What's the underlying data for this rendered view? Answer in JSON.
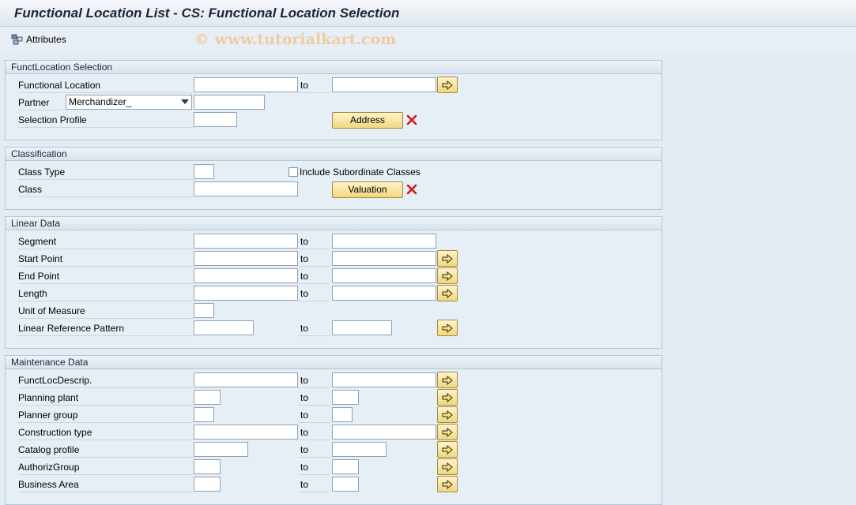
{
  "window": {
    "title": "Functional Location List - CS: Functional Location Selection"
  },
  "toolbar": {
    "attributes_label": "Attributes",
    "watermark": "© www.tutorialkart.com"
  },
  "common": {
    "to_label": "to"
  },
  "funct_selection": {
    "header": "FunctLocation Selection",
    "functional_location_label": "Functional Location",
    "partner_label": "Partner",
    "partner_value": "Merchandizer_",
    "selection_profile_label": "Selection Profile",
    "address_button": "Address"
  },
  "classification": {
    "header": "Classification",
    "class_type_label": "Class Type",
    "include_subordinate_label": "Include Subordinate Classes",
    "include_subordinate_checked": false,
    "class_label": "Class",
    "valuation_button": "Valuation"
  },
  "linear_data": {
    "header": "Linear Data",
    "segment_label": "Segment",
    "start_point_label": "Start Point",
    "end_point_label": "End Point",
    "length_label": "Length",
    "unit_of_measure_label": "Unit of Measure",
    "linear_reference_pattern_label": "Linear Reference Pattern"
  },
  "maintenance_data": {
    "header": "Maintenance Data",
    "funct_loc_descrip_label": "FunctLocDescrip.",
    "planning_plant_label": "Planning plant",
    "planner_group_label": "Planner group",
    "construction_type_label": "Construction type",
    "catalog_profile_label": "Catalog profile",
    "authoriz_group_label": "AuthorizGroup",
    "business_area_label": "Business Area"
  },
  "icons": {
    "multiple_selection": "arrow-right-icon",
    "delete": "delete-x-icon",
    "attributes": "attributes-icon"
  },
  "colors": {
    "button_yellow": "#f1d77e",
    "background": "#e3ebf3",
    "delete_red": "#d11a1a"
  }
}
